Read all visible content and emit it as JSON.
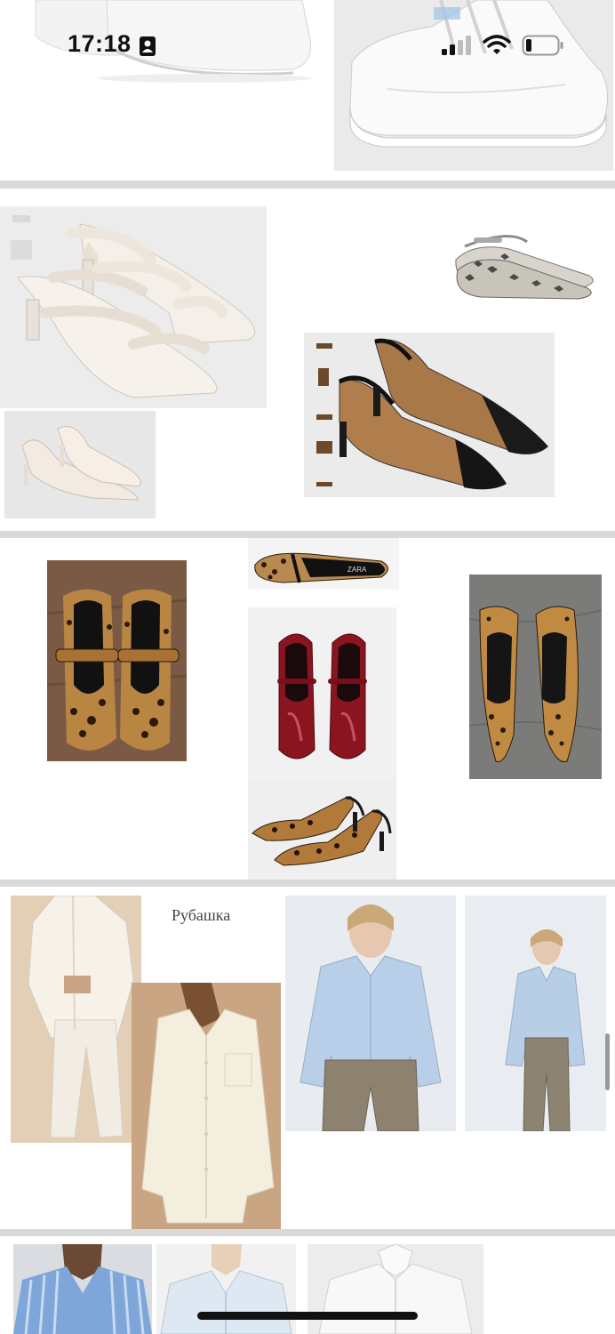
{
  "status_bar": {
    "time": "17:18"
  },
  "boards": [
    {
      "name": "sneakers"
    },
    {
      "name": "heels-and-flats"
    },
    {
      "name": "leopard-and-mary-janes"
    },
    {
      "name": "shirts",
      "label": "Рубашка"
    },
    {
      "name": "striped-shirts"
    }
  ],
  "icons": [
    "contact-card-icon",
    "cellular-signal-icon",
    "wifi-icon",
    "battery-icon"
  ],
  "colors": {
    "board_bg": "#ffffff",
    "page_bg": "#d9d9d9",
    "leopard": "#b07a3c",
    "patent_red": "#8a1520",
    "shirt_blue": "#b7cde9"
  }
}
